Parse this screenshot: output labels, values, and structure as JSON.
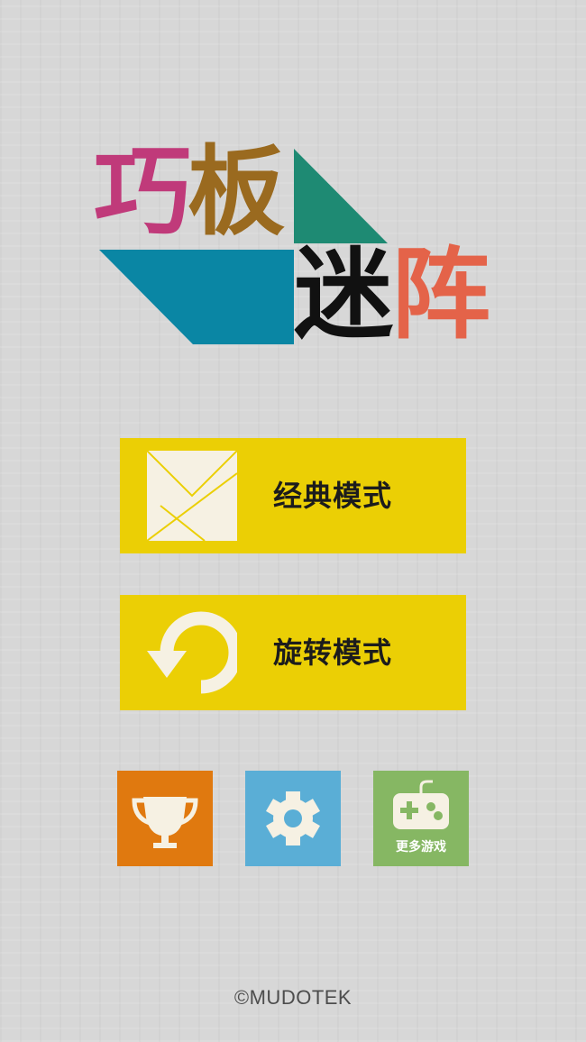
{
  "logo": {
    "chars": [
      "巧",
      "板",
      "迷",
      "阵"
    ],
    "colors": {
      "magenta": "#c03a7a",
      "brown": "#9a6a1f",
      "teal": "#1e8a73",
      "blue": "#0a86a4",
      "black": "#111111",
      "coral": "#e46349"
    }
  },
  "menu": {
    "classic_label": "经典模式",
    "rotate_label": "旋转模式",
    "button_color": "#ebcf05",
    "icon_color": "#f6f1e3"
  },
  "small_buttons": {
    "trophy": {
      "icon": "trophy-icon",
      "color": "#e0790f"
    },
    "settings": {
      "icon": "gear-icon",
      "color": "#5aaed6"
    },
    "more_games": {
      "icon": "gamepad-icon",
      "color": "#86b763",
      "label": "更多游戏"
    }
  },
  "footer": {
    "copyright": "©MUDOTEK"
  }
}
